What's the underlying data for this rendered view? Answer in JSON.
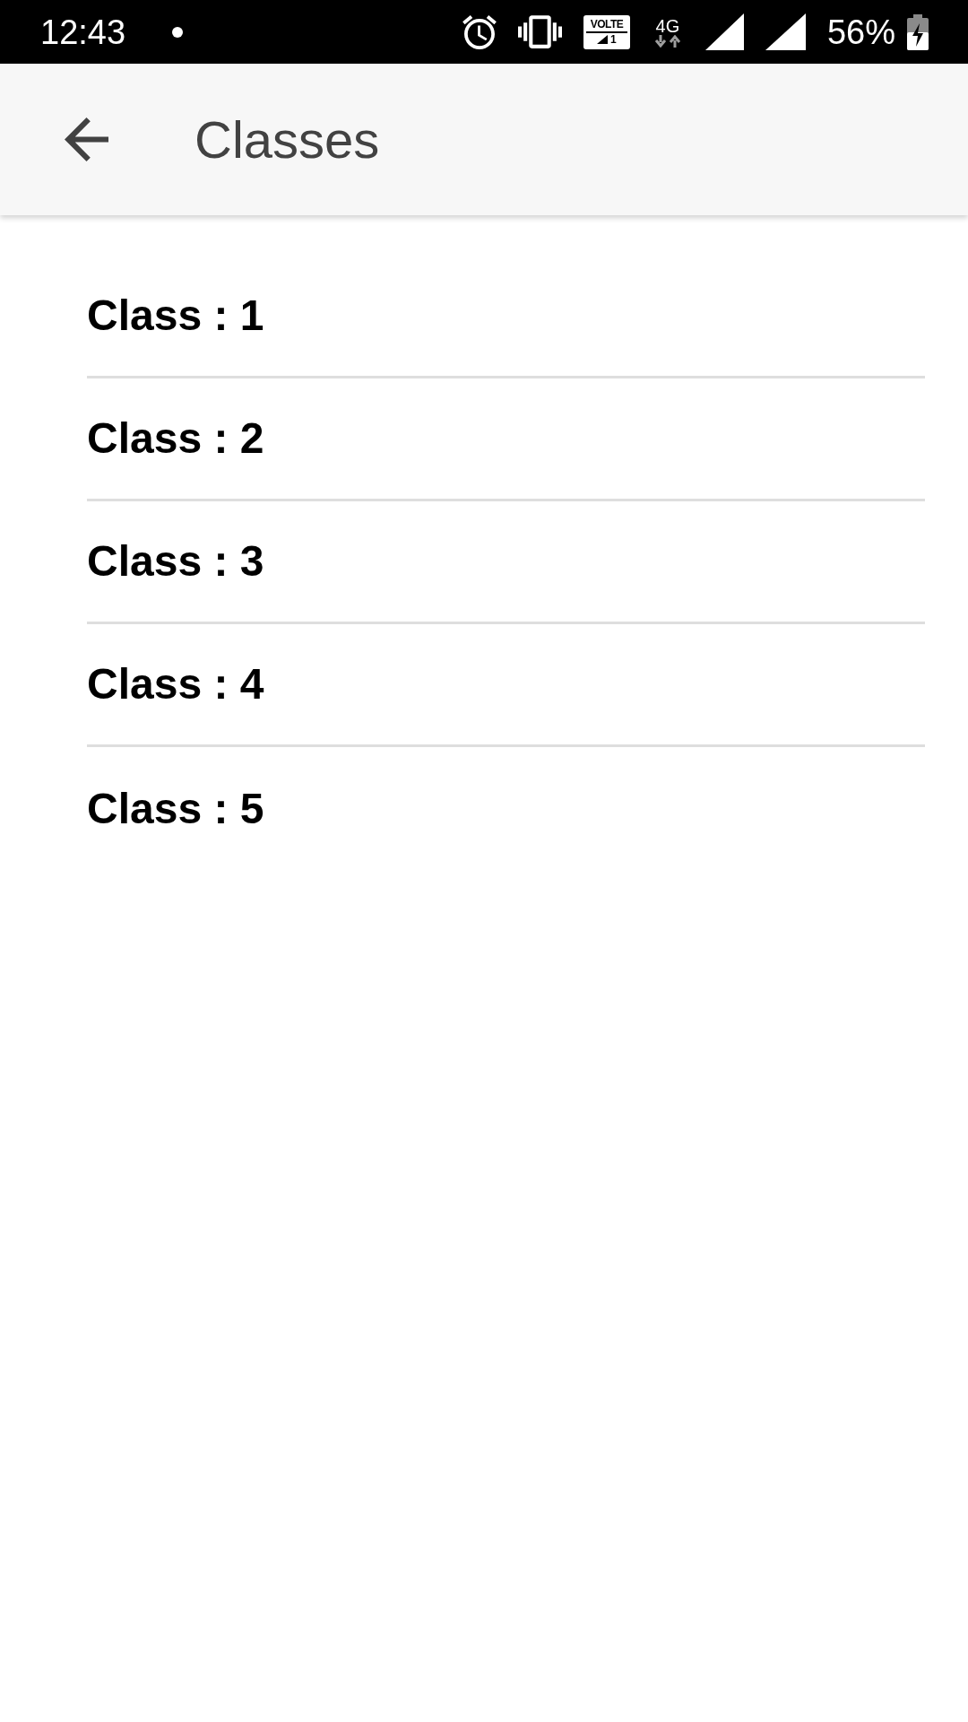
{
  "status_bar": {
    "time": "12:43",
    "volte_label": "VOLTE",
    "volte_sim": "1",
    "network_type": "4G",
    "battery": "56%"
  },
  "app_bar": {
    "title": "Classes"
  },
  "items": [
    "Class : 1",
    "Class : 2",
    "Class : 3",
    "Class : 4",
    "Class : 5"
  ]
}
